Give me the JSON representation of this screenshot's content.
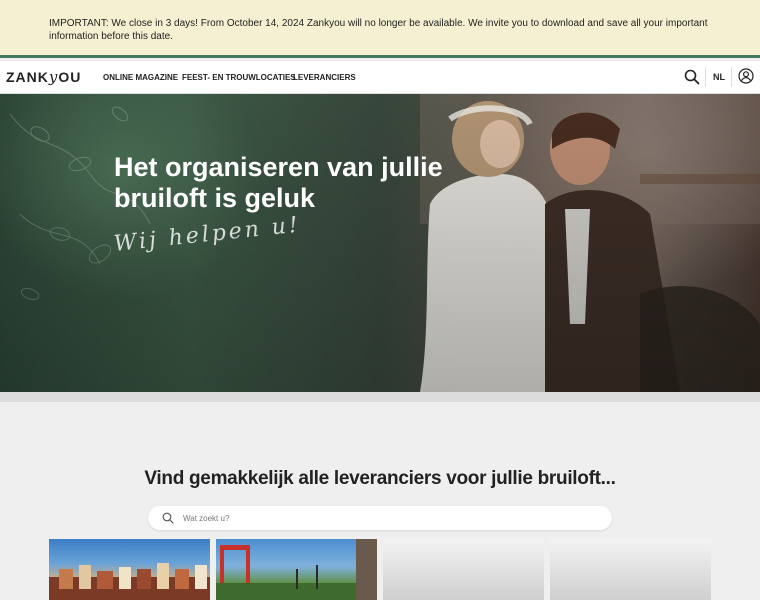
{
  "banner": {
    "text": "IMPORTANT: We close in 3 days! From October 14, 2024 Zankyou will no longer be available. We invite you to download and save all your important information before this date."
  },
  "nav": {
    "logo_part1": "ZANK",
    "logo_part2": "y",
    "logo_part3": "OU",
    "items": [
      "ONLINE MAGAZINE",
      "FEEST- EN TROUWLOCATIES",
      "LEVERANCIERS"
    ],
    "language": "NL",
    "search_icon": "search-icon",
    "user_icon": "user-icon"
  },
  "hero": {
    "title": "Het organiseren van jullie bruiloft is geluk",
    "script": "Wij helpen u!"
  },
  "finder": {
    "heading": "Vind gemakkelijk alle leveranciers voor jullie bruiloft...",
    "placeholder": "Wat zoekt u?"
  },
  "colors": {
    "banner_bg": "#f6f0d3",
    "banner_border": "#3f7a5f",
    "page_bg": "#efefef"
  }
}
